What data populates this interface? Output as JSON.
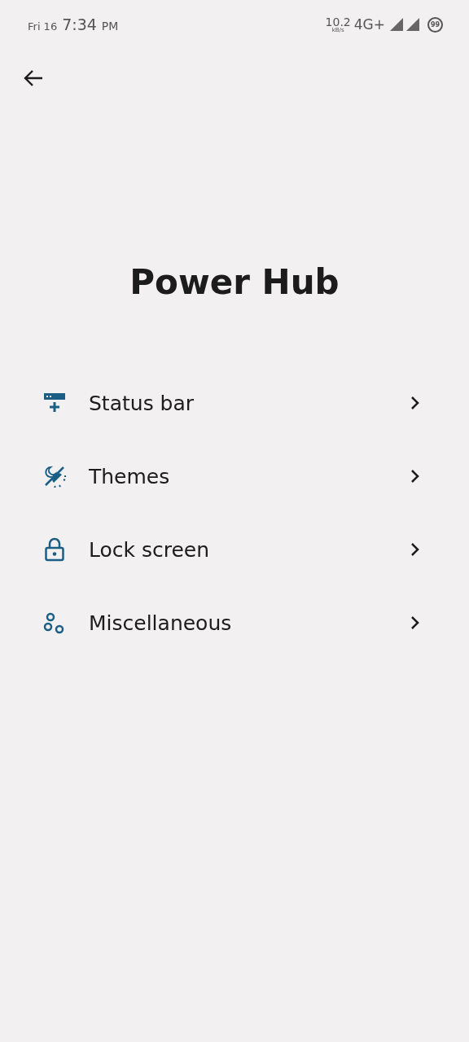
{
  "status_bar": {
    "date": "Fri 16",
    "time": "7:34",
    "meridiem": "PM",
    "speed": "10.2",
    "speed_unit": "kB/s",
    "network": "4G+",
    "battery": "99"
  },
  "title": "Power Hub",
  "items": [
    {
      "kind": "statusbar",
      "label": "Status bar"
    },
    {
      "kind": "themes",
      "label": "Themes"
    },
    {
      "kind": "lock",
      "label": "Lock screen"
    },
    {
      "kind": "misc",
      "label": "Miscellaneous"
    }
  ]
}
